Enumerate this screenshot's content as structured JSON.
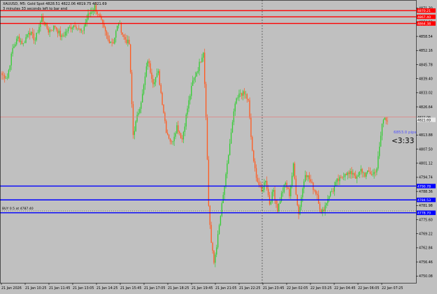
{
  "header": {
    "symbol_line": "XAUUSD, M5:  Gold Spot  4828.51 4822.06 4819.75 4821.69",
    "timer_line": "3 minutes 33 seconds left to bar end"
  },
  "countdown": "<3:33",
  "spread_label": "6853.0 pips",
  "buy_label": "BUY 0.5 at 4787.40",
  "colors": {
    "background": "#c0c0c0",
    "bull": "#32cd32",
    "bear": "#ff5a1f",
    "resistance_line": "#ff0000",
    "support_line": "#0000ff",
    "price_line": "#e08080",
    "axis_text": "#000000"
  },
  "y_ticks": [
    "4871.30",
    "4864.92",
    "4858.54",
    "4852.16",
    "4845.78",
    "4839.40",
    "4833.02",
    "4826.64",
    "4820.26",
    "4813.88",
    "4807.50",
    "4801.12",
    "4794.74",
    "4788.36",
    "4781.98",
    "4775.60",
    "4769.22",
    "4762.84",
    "4756.46",
    "4750.08"
  ],
  "x_ticks": [
    "21 Jan 2026",
    "21 Jan 10:25",
    "21 Jan 11:45",
    "21 Jan 13:05",
    "21 Jan 14:25",
    "21 Jan 15:45",
    "21 Jan 17:05",
    "21 Jan 18:25",
    "21 Jan 19:45",
    "21 Jan 21:05",
    "21 Jan 22:25",
    "21 Jan 23:45",
    "22 Jan 02:05",
    "22 Jan 03:25",
    "22 Jan 04:45",
    "22 Jan 06:05",
    "22 Jan 07:25"
  ],
  "levels": {
    "red": [
      "4870.21",
      "4867.40",
      "4864.38"
    ],
    "blue": [
      "4790.78",
      "4784.53",
      "4778.70"
    ],
    "current": "4822.06",
    "current_alt": "4821.69"
  },
  "chart_data": {
    "type": "candlestick",
    "series": "XAUUSD M5",
    "ylim": [
      4747,
      4875
    ],
    "anchors": [
      [
        0,
        4841
      ],
      [
        4,
        4840
      ],
      [
        8,
        4853
      ],
      [
        12,
        4858
      ],
      [
        16,
        4855
      ],
      [
        20,
        4861
      ],
      [
        25,
        4857
      ],
      [
        30,
        4867
      ],
      [
        35,
        4861
      ],
      [
        40,
        4863
      ],
      [
        45,
        4858
      ],
      [
        50,
        4862
      ],
      [
        55,
        4864
      ],
      [
        60,
        4860
      ],
      [
        65,
        4868
      ],
      [
        70,
        4872
      ],
      [
        75,
        4865
      ],
      [
        80,
        4857
      ],
      [
        84,
        4856
      ],
      [
        88,
        4865
      ],
      [
        92,
        4858
      ],
      [
        96,
        4855
      ],
      [
        99,
        4814
      ],
      [
        102,
        4822
      ],
      [
        106,
        4832
      ],
      [
        110,
        4848
      ],
      [
        114,
        4838
      ],
      [
        118,
        4842
      ],
      [
        120,
        4833
      ],
      [
        124,
        4816
      ],
      [
        128,
        4810
      ],
      [
        132,
        4818
      ],
      [
        136,
        4812
      ],
      [
        140,
        4826
      ],
      [
        144,
        4838
      ],
      [
        148,
        4844
      ],
      [
        152,
        4852
      ],
      [
        154,
        4823
      ],
      [
        156,
        4782
      ],
      [
        158,
        4765
      ],
      [
        160,
        4756
      ],
      [
        163,
        4768
      ],
      [
        166,
        4782
      ],
      [
        169,
        4795
      ],
      [
        172,
        4810
      ],
      [
        176,
        4828
      ],
      [
        180,
        4833
      ],
      [
        184,
        4832
      ],
      [
        186,
        4829
      ],
      [
        188,
        4813
      ],
      [
        190,
        4801
      ],
      [
        193,
        4793
      ],
      [
        196,
        4788
      ],
      [
        199,
        4794
      ],
      [
        202,
        4783
      ],
      [
        205,
        4789
      ],
      [
        208,
        4780
      ],
      [
        211,
        4787
      ],
      [
        214,
        4792
      ],
      [
        217,
        4787
      ],
      [
        220,
        4800
      ],
      [
        222,
        4788
      ],
      [
        224,
        4778
      ],
      [
        226,
        4786
      ],
      [
        229,
        4797
      ],
      [
        232,
        4794
      ],
      [
        235,
        4790
      ],
      [
        238,
        4787
      ],
      [
        241,
        4778
      ],
      [
        244,
        4782
      ],
      [
        247,
        4787
      ],
      [
        250,
        4789
      ],
      [
        253,
        4793
      ],
      [
        256,
        4794
      ],
      [
        259,
        4797
      ],
      [
        262,
        4796
      ],
      [
        265,
        4797
      ],
      [
        268,
        4794
      ],
      [
        271,
        4798
      ],
      [
        274,
        4796
      ],
      [
        277,
        4797
      ],
      [
        280,
        4796
      ],
      [
        283,
        4799
      ],
      [
        285,
        4808
      ],
      [
        287,
        4819
      ],
      [
        289,
        4822
      ],
      [
        291,
        4821
      ]
    ],
    "total_bars": 292,
    "current_price": 4822.06
  }
}
